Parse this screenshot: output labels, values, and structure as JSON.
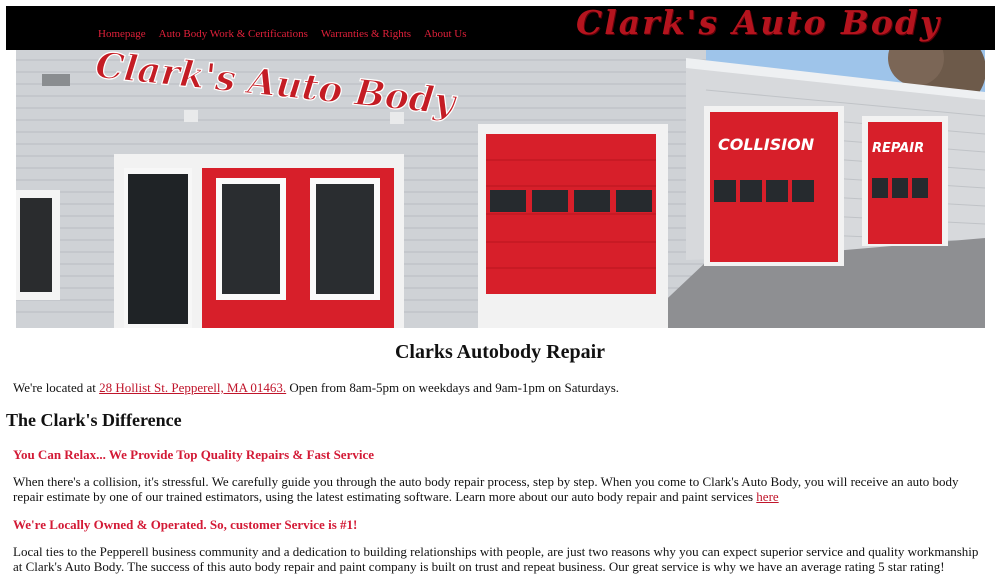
{
  "nav": {
    "items": [
      "Homepage",
      "Auto Body Work & Certifications",
      "Warranties & Rights",
      "About Us"
    ]
  },
  "brand": {
    "logo_text": "Clark's Auto Body"
  },
  "hero": {
    "building_sign": "Clark's Auto Body",
    "door_sign_1": "COLLISION",
    "door_sign_2": "REPAIR"
  },
  "main": {
    "title": "Clarks Autobody Repair",
    "location_prefix": "We're located at ",
    "address": "28 Hollist St. Pepperell, MA 01463.",
    "hours": " Open from 8am-5pm on weekdays and 9am-1pm on Saturdays.",
    "difference_heading": "The Clark's Difference",
    "section1_heading": "You Can Relax... We Provide Top Quality Repairs & Fast Service",
    "section1_text": "When there's a collision, it's stressful. We carefully guide you through the auto body repair process, step by step. When you come to Clark's Auto Body, you will receive an auto body repair estimate by one of our trained estimators, using the latest estimating software. Learn more about our auto body repair and paint services ",
    "section1_link": "here",
    "section2_heading": "We're Locally Owned & Operated. So, customer Service is #1!",
    "section2_text": "Local ties to the Pepperell business community and a dedication to building relationships with people, are just two reasons why you can expect superior service and quality workmanship at Clark's Auto Body. The success of this auto body repair and paint company is built on trust and repeat business. Our great service is why we have an average rating 5 star rating!"
  },
  "colors": {
    "accent_red": "#d31a36",
    "topbar": "#000000",
    "door_red": "#d71f2a"
  }
}
